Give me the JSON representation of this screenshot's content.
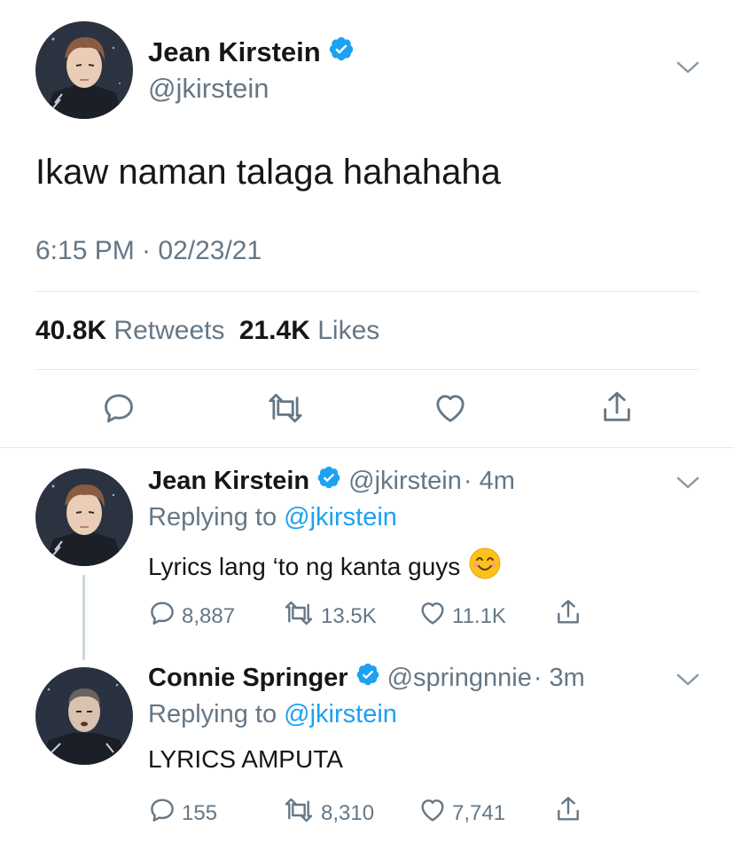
{
  "main_tweet": {
    "author_name": "Jean Kirstein",
    "author_handle": "@jkirstein",
    "text": "Ikaw naman talaga hahahaha",
    "timestamp": "6:15 PM · 02/23/21",
    "retweets_count": "40.8K",
    "retweets_label": "Retweets",
    "likes_count": "21.4K",
    "likes_label": "Likes",
    "actions": [
      "reply-icon",
      "retweet-icon",
      "like-icon",
      "share-icon"
    ]
  },
  "replies": [
    {
      "author_name": "Jean Kirstein",
      "author_handle": "@jkirstein",
      "time_ago": "· 4m",
      "replying_prefix": "Replying to",
      "replying_to": "@jkirstein",
      "text": "Lyrics lang ‘to ng kanta guys",
      "emoji": "smiling-face-icon",
      "reply_count": "8,887",
      "retweet_count": "13.5K",
      "like_count": "11.1K"
    },
    {
      "author_name": "Connie Springer",
      "author_handle": "@springnnie",
      "time_ago": "· 3m",
      "replying_prefix": "Replying to",
      "replying_to": "@jkirstein",
      "text": "LYRICS AMPUTA",
      "reply_count": "155",
      "retweet_count": "8,310",
      "like_count": "7,741"
    }
  ],
  "colors": {
    "accent": "#1da1f2",
    "muted": "#657786",
    "divider": "#e1e8ed",
    "text": "#14171a"
  }
}
